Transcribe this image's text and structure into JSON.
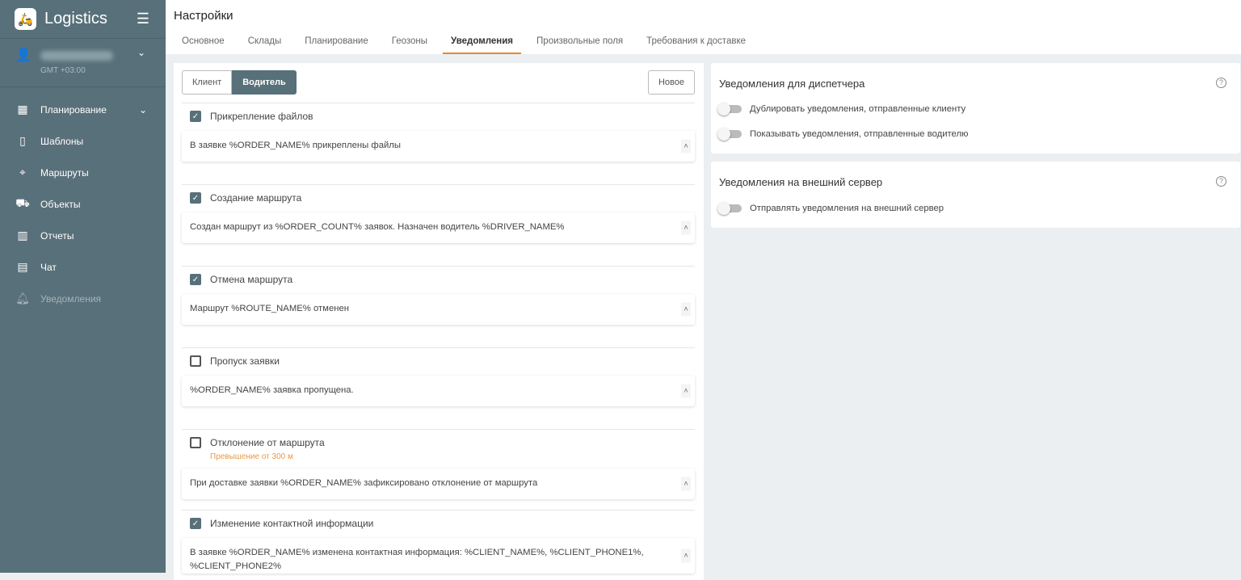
{
  "sidebar": {
    "brand": "Logistics",
    "timezone": "GMT +03:00",
    "items": [
      {
        "label": "Планирование",
        "icon": "calendar-icon"
      },
      {
        "label": "Шаблоны",
        "icon": "template-icon"
      },
      {
        "label": "Маршруты",
        "icon": "route-icon"
      },
      {
        "label": "Объекты",
        "icon": "car-icon"
      },
      {
        "label": "Отчеты",
        "icon": "report-icon"
      },
      {
        "label": "Чат",
        "icon": "chat-icon"
      },
      {
        "label": "Уведомления",
        "icon": "bell-icon"
      }
    ]
  },
  "header": {
    "title": "Настройки",
    "tabs": [
      "Основное",
      "Склады",
      "Планирование",
      "Геозоны",
      "Уведомления",
      "Произвольные поля",
      "Требования к доставке"
    ],
    "active_tab": "Уведомления"
  },
  "left": {
    "seg": [
      "Клиент",
      "Водитель"
    ],
    "active_seg": "Водитель",
    "new_label": "Новое",
    "sections": [
      {
        "label": "Прикрепление файлов",
        "checked": true,
        "text": "В заявке %ORDER_NAME% прикреплены файлы"
      },
      {
        "label": "Создание маршрута",
        "checked": true,
        "text": "Создан маршрут из %ORDER_COUNT% заявок. Назначен водитель %DRIVER_NAME%"
      },
      {
        "label": "Отмена маршрута",
        "checked": true,
        "text": "Маршрут %ROUTE_NAME% отменен"
      },
      {
        "label": "Пропуск заявки",
        "checked": false,
        "text": "%ORDER_NAME% заявка пропущена."
      },
      {
        "label": "Отклонение от маршрута",
        "checked": false,
        "hint": "Превышение от 300 м",
        "text": "При доставке заявки %ORDER_NAME% зафиксировано отклонение от маршрута"
      },
      {
        "label": "Изменение контактной информации",
        "checked": true,
        "text": "В заявке %ORDER_NAME% изменена контактная информация: %CLIENT_NAME%, %CLIENT_PHONE1%, %CLIENT_PHONE2%"
      }
    ]
  },
  "right": {
    "dispatcher": {
      "title": "Уведомления для диспетчера",
      "toggles": [
        {
          "label": "Дублировать уведомления, отправленные клиенту",
          "on": false
        },
        {
          "label": "Показывать уведомления, отправленные водителю",
          "on": false
        }
      ]
    },
    "external": {
      "title": "Уведомления на внешний сервер",
      "toggles": [
        {
          "label": "Отправлять уведомления на внешний сервер",
          "on": false
        }
      ]
    }
  },
  "colors": {
    "sidebar": "#587079",
    "accent": "#e68a2e"
  }
}
